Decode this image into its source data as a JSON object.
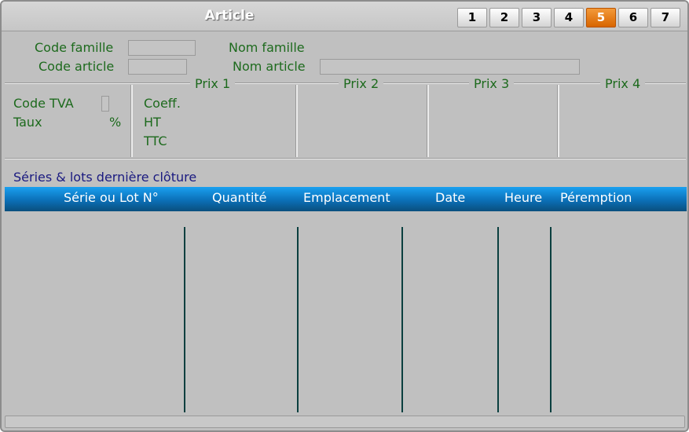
{
  "window": {
    "title": "Article"
  },
  "tabs": [
    {
      "label": "1",
      "active": false
    },
    {
      "label": "2",
      "active": false
    },
    {
      "label": "3",
      "active": false
    },
    {
      "label": "4",
      "active": false
    },
    {
      "label": "5",
      "active": true
    },
    {
      "label": "6",
      "active": false
    },
    {
      "label": "7",
      "active": false
    }
  ],
  "header_fields": {
    "code_famille_label": "Code famille",
    "code_famille_value": "",
    "nom_famille_label": "Nom famille",
    "code_article_label": "Code article",
    "code_article_value": "",
    "nom_article_label": "Nom article",
    "nom_article_value": ""
  },
  "tva": {
    "code_tva_label": "Code TVA",
    "code_tva_value": "",
    "taux_label": "Taux",
    "percent_sign": "%"
  },
  "prices": {
    "prix1_label": "Prix 1",
    "prix2_label": "Prix 2",
    "prix3_label": "Prix 3",
    "prix4_label": "Prix 4",
    "coeff_label": "Coeff.",
    "ht_label": "HT",
    "ttc_label": "TTC"
  },
  "lots_section": {
    "title": "Séries & lots dernière clôture",
    "columns": [
      "Série ou Lot N°",
      "Quantité",
      "Emplacement",
      "Date",
      "Heure",
      "Péremption"
    ],
    "rows": []
  },
  "colors": {
    "window_bg": "#c0c0c0",
    "label_green": "#1d6a1d",
    "section_blue": "#1a1a80",
    "active_tab_orange": "#e87a10",
    "grid_header_blue": "#0b6fb7"
  }
}
